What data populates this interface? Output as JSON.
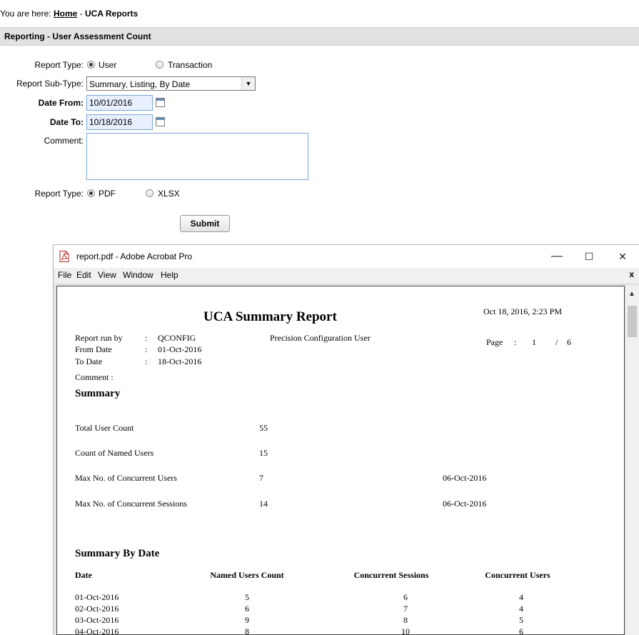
{
  "breadcrumb": {
    "prefix": "You are here:",
    "home": "Home",
    "sep": "-",
    "current": "UCA Reports"
  },
  "section_title": "Reporting - User Assessment Count",
  "form": {
    "report_type_label": "Report Type:",
    "report_type_options": [
      "User",
      "Transaction"
    ],
    "report_type_selected": "User",
    "sub_type_label": "Report Sub-Type:",
    "sub_type_value": "Summary, Listing, By Date",
    "date_from_label": "Date From:",
    "date_from_value": "10/01/2016",
    "date_to_label": "Date To:",
    "date_to_value": "10/18/2016",
    "comment_label": "Comment:",
    "comment_value": "",
    "format_label": "Report Type:",
    "format_options": [
      "PDF",
      "XLSX"
    ],
    "format_selected": "PDF",
    "submit_label": "Submit"
  },
  "acrobat": {
    "title": "report.pdf - Adobe Acrobat Pro",
    "controls": {
      "minimize": "—",
      "maximize": "☐",
      "close": "✕"
    },
    "menu": [
      "File",
      "Edit",
      "View",
      "Window",
      "Help"
    ],
    "menu_close": "x"
  },
  "report": {
    "title": "UCA Summary Report",
    "datetime": "Oct 18, 2016, 2:23 PM",
    "meta": [
      {
        "label": "Report run by",
        "sep": ":",
        "value": "QCONFIG"
      },
      {
        "label": "From Date",
        "sep": ":",
        "value": "01-Oct-2016"
      },
      {
        "label": "To Date",
        "sep": ":",
        "value": "18-Oct-2016"
      },
      {
        "label": "Comment :",
        "sep": "",
        "value": ""
      }
    ],
    "user_name": "Precision Configuration User",
    "page_label": "Page",
    "page_sep": ":",
    "page_current": "1",
    "page_slash": "/",
    "page_total": "6",
    "summary_heading": "Summary",
    "summary": [
      {
        "label": "Total User Count",
        "value": "55",
        "date": ""
      },
      {
        "label": "Count of Named Users",
        "value": "15",
        "date": ""
      },
      {
        "label": "Max No. of Concurrent Users",
        "value": "7",
        "date": "06-Oct-2016"
      },
      {
        "label": "Max No. of Concurrent Sessions",
        "value": "14",
        "date": "06-Oct-2016"
      }
    ],
    "by_date_heading": "Summary By Date",
    "columns": [
      "Date",
      "Named Users Count",
      "Concurrent Sessions",
      "Concurrent Users"
    ],
    "rows": [
      [
        "01-Oct-2016",
        "5",
        "6",
        "4"
      ],
      [
        "02-Oct-2016",
        "6",
        "7",
        "4"
      ],
      [
        "03-Oct-2016",
        "9",
        "8",
        "5"
      ],
      [
        "04-Oct-2016",
        "8",
        "10",
        "6"
      ]
    ]
  }
}
